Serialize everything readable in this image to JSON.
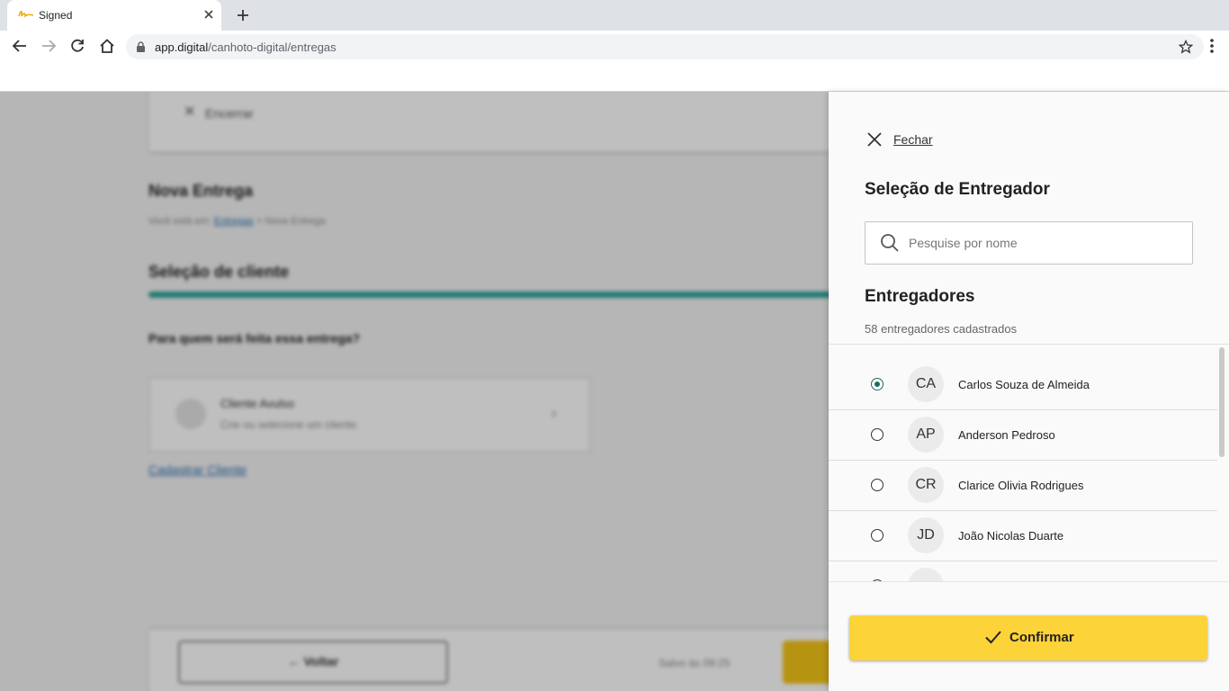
{
  "browser": {
    "tab_title": "Signed",
    "url_host": "app.digital",
    "url_path": "/canhoto-digital/entregas"
  },
  "background": {
    "encerrar": "Encerrar",
    "page_title": "Nova Entrega",
    "breadcrumb_prefix": "Você está em:",
    "breadcrumb_link": "Entregas",
    "breadcrumb_sep": ">",
    "breadcrumb_current": "Nova Entrega",
    "step_title": "Seleção de cliente",
    "question": "Para quem será feita essa entrega?",
    "client_name": "Cliente Avulso",
    "client_desc": "Crie ou selecione um cliente.",
    "register_link": "Cadastrar Cliente",
    "back_label": "Voltar",
    "saved_text": "Salvo às 09:25"
  },
  "panel": {
    "close_label": "Fechar",
    "title": "Seleção de Entregador",
    "search_placeholder": "Pesquise por nome",
    "section_title": "Entregadores",
    "count_text": "58 entregadores cadastrados",
    "confirm_label": "Confirmar",
    "couriers": [
      {
        "initials": "CA",
        "name": "Carlos Souza de Almeida",
        "selected": true
      },
      {
        "initials": "AP",
        "name": "Anderson Pedroso",
        "selected": false
      },
      {
        "initials": "CR",
        "name": "Clarice Olivia Rodrigues",
        "selected": false
      },
      {
        "initials": "JD",
        "name": "João Nicolas Duarte",
        "selected": false
      }
    ]
  },
  "colors": {
    "accent_yellow": "#fdd33a",
    "radio_selected": "#1b6b5f",
    "progress": "#2aa39a"
  }
}
